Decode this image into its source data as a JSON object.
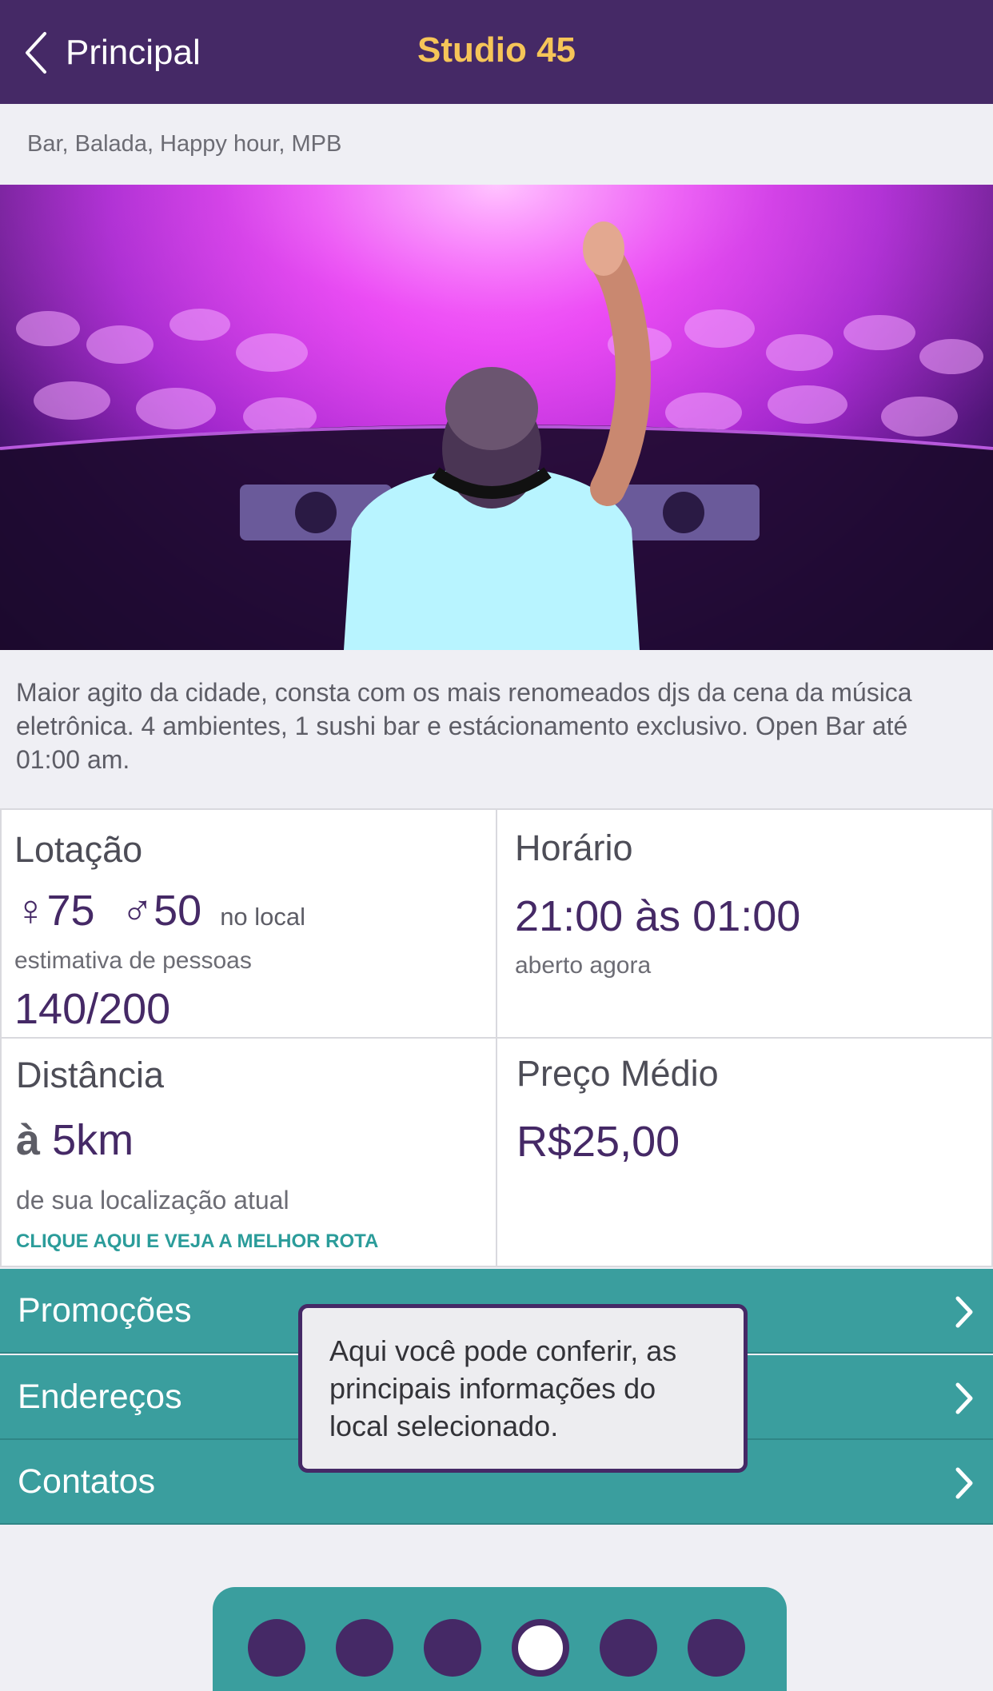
{
  "navbar": {
    "back_label": "Principal",
    "title": "Studio 45"
  },
  "venue": {
    "tags": "Bar, Balada, Happy hour, MPB",
    "description": "Maior agito da cidade, consta com os mais renomeados djs da cena da música eletrônica. 4 ambientes, 1 sushi bar e estácionamento exclusivo. Open Bar até 01:00 am."
  },
  "lotacao": {
    "title": "Lotação",
    "female_symbol": "♀",
    "female_count": "75",
    "male_symbol": "♂",
    "male_count": "50",
    "suffix": "no local",
    "estimate_label": "estimativa de pessoas",
    "capacity": "140/200"
  },
  "horario": {
    "title": "Horário",
    "hours": "21:00 às 01:00",
    "status": "aberto agora"
  },
  "distancia": {
    "title": "Distância",
    "prefix": "à",
    "value": "5km",
    "subtitle": "de sua localização atual",
    "route_link": "CLIQUE AQUI E VEJA A MELHOR ROTA"
  },
  "preco": {
    "title": "Preço Médio",
    "value": "R$25,00"
  },
  "menu": [
    {
      "label": "Promoções"
    },
    {
      "label": "Endereços"
    },
    {
      "label": "Contatos"
    }
  ],
  "tooltip": {
    "text": "Aqui você pode conferir, as principais informações do local selecionado."
  },
  "pager": {
    "count": 6,
    "active_index": 3
  },
  "colors": {
    "primary_purple": "#452966",
    "title_gold": "#f6c558",
    "teal": "#3a9e9e",
    "link_teal": "#2b9c9a"
  }
}
